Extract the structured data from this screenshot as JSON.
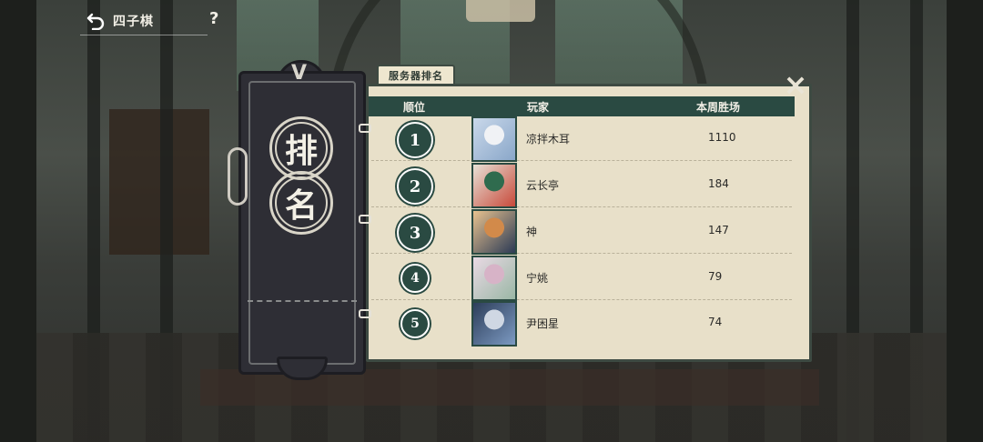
{
  "topbar": {
    "title": "四子棋",
    "help": "?"
  },
  "badge": {
    "char1": "排",
    "char2": "名",
    "mark": "V"
  },
  "panel": {
    "tab_label": "服务器排名",
    "close": "×"
  },
  "table": {
    "headers": {
      "rank": "顺位",
      "player": "玩家",
      "wins": "本周胜场"
    },
    "rows": [
      {
        "rank": "1",
        "name": "凉拌木耳",
        "wins": "1110",
        "avatar_colors": [
          "#c9d8ea",
          "#8aa7c9",
          "#f0f2f5"
        ]
      },
      {
        "rank": "2",
        "name": "云长亭",
        "wins": "184",
        "avatar_colors": [
          "#e7e1d6",
          "#c84a3b",
          "#2f6b4e"
        ]
      },
      {
        "rank": "3",
        "name": "神",
        "wins": "147",
        "avatar_colors": [
          "#e8c28f",
          "#2b3a55",
          "#d28a4a"
        ]
      },
      {
        "rank": "4",
        "name": "宁姚",
        "wins": "79",
        "avatar_colors": [
          "#e9d9e4",
          "#9ab7a5",
          "#d7b3c7"
        ]
      },
      {
        "rank": "5",
        "name": "尹困星",
        "wins": "74",
        "avatar_colors": [
          "#2d3e5a",
          "#7c9ac2",
          "#cfd7e3"
        ]
      }
    ]
  },
  "colors": {
    "accent": "#2a4a42",
    "paper": "#e8e0c9",
    "badge": "#2e2e35"
  }
}
